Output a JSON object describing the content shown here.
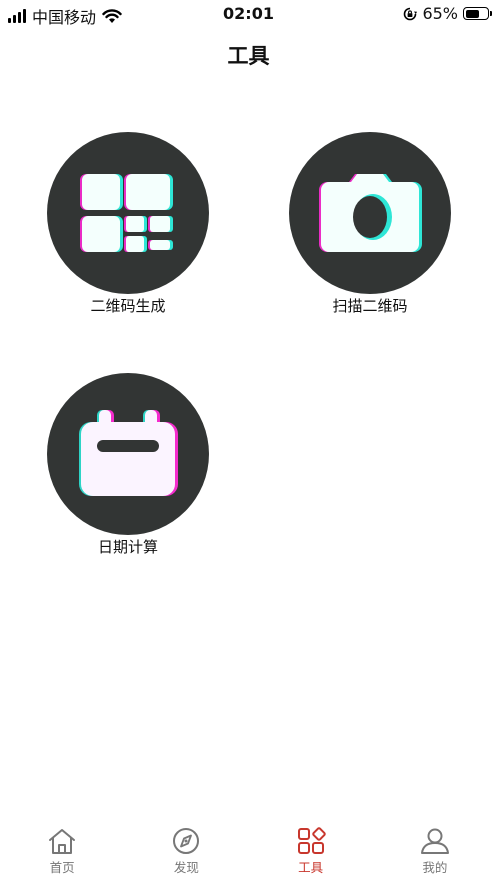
{
  "status_bar": {
    "carrier": "中国移动",
    "time": "02:01",
    "battery": "65%",
    "battery_level": 0.65,
    "icons": [
      "signal-icon",
      "wifi-icon",
      "orientation-lock-icon",
      "battery-icon"
    ]
  },
  "header": {
    "title": "工具"
  },
  "tools": [
    {
      "label": "二维码生成",
      "icon": "qr-grid-icon"
    },
    {
      "label": "扫描二维码",
      "icon": "camera-icon"
    },
    {
      "label": "日期计算",
      "icon": "calendar-icon"
    }
  ],
  "tab_bar": {
    "items": [
      {
        "label": "首页",
        "icon": "home-icon",
        "active": false
      },
      {
        "label": "发现",
        "icon": "compass-icon",
        "active": false
      },
      {
        "label": "工具",
        "icon": "tools-icon",
        "active": true
      },
      {
        "label": "我的",
        "icon": "user-icon",
        "active": false
      }
    ]
  },
  "colors": {
    "circle_bg": "#323534",
    "active_tab": "#c8372d",
    "inactive_tab": "#777777",
    "icon_fill": "#f4fffd",
    "glitch_cyan": "#2ee6d6",
    "glitch_magenta": "#ff2bd6"
  }
}
